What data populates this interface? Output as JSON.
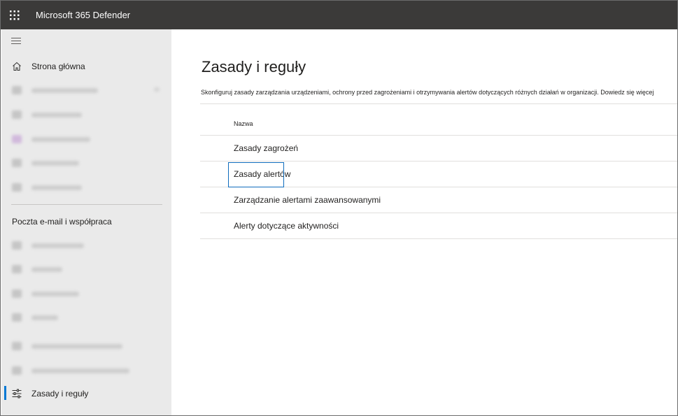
{
  "app": {
    "title": "Microsoft 365 Defender"
  },
  "sidebar": {
    "home_label": "Strona główna",
    "section_title": "Poczta e-mail i współpraca",
    "active_item_label": "Zasady i reguły",
    "active_item_icon": "policy-sliders-icon"
  },
  "main": {
    "title": "Zasady i reguły",
    "description": "Skonfiguruj zasady zarządzania urządzeniami, ochrony przed zagrożeniami i otrzymywania alertów dotyczących różnych działań w organizacji.",
    "learn_more": "Dowiedz się więcej",
    "table": {
      "header": "Nazwa",
      "rows": [
        "Zasady zagrożeń",
        "Zasady alertów",
        "Zarządzanie alertami zaawansowanymi",
        "Alerty dotyczące aktywności"
      ],
      "focused_row": 1
    }
  },
  "colors": {
    "topbar": "#3b3a39",
    "sidebar": "#eaeaea",
    "accent": "#0078d4",
    "focus": "#0f6cbd"
  }
}
